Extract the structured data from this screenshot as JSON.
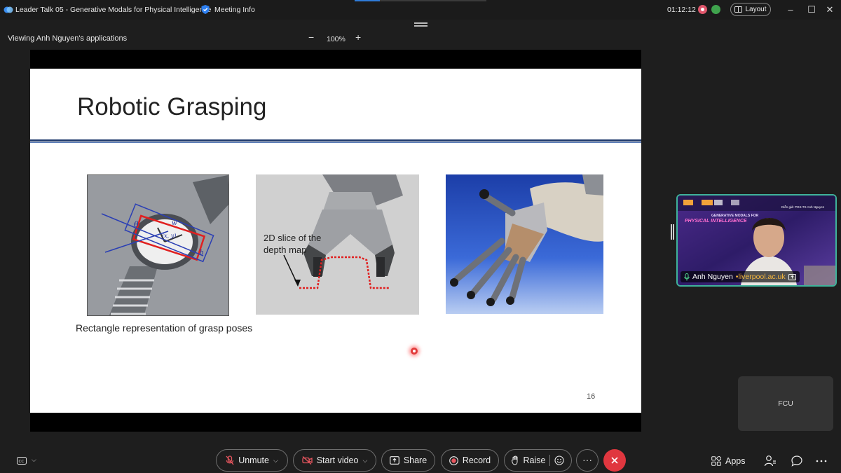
{
  "titlebar": {
    "window_title": "Leader Talk 05 - Generative Modals for Physical Intelligence",
    "meeting_info": "Meeting Info",
    "timer": "01:12:12",
    "layout_label": "Layout"
  },
  "share_bar": {
    "viewing_label": "Viewing Anh Nguyen's applications",
    "zoom_out": "−",
    "zoom_level": "100%",
    "zoom_in": "+"
  },
  "slide": {
    "title": "Robotic Grasping",
    "watch_labels": [
      "θ",
      "(x, y)",
      "w",
      "h"
    ],
    "gripper_label_line1": "2D slice of the",
    "gripper_label_line2": "depth map",
    "caption": "Rectangle representation of grasp poses",
    "page_number": "16"
  },
  "video": {
    "speaker_name": "Anh Nguyen",
    "speaker_org": "liverpool.ac.uk",
    "banner_top": "GENERATIVE MODALS FOR",
    "banner_main": "PHYSICAL INTELLIGENCE",
    "banner_small": "Diễn giả: PGS.TS Anh Nguyen",
    "other_tile": "FCU"
  },
  "controls": {
    "unmute": "Unmute",
    "start_video": "Start video",
    "share": "Share",
    "record": "Record",
    "raise": "Raise",
    "more": "···",
    "apps": "Apps"
  }
}
